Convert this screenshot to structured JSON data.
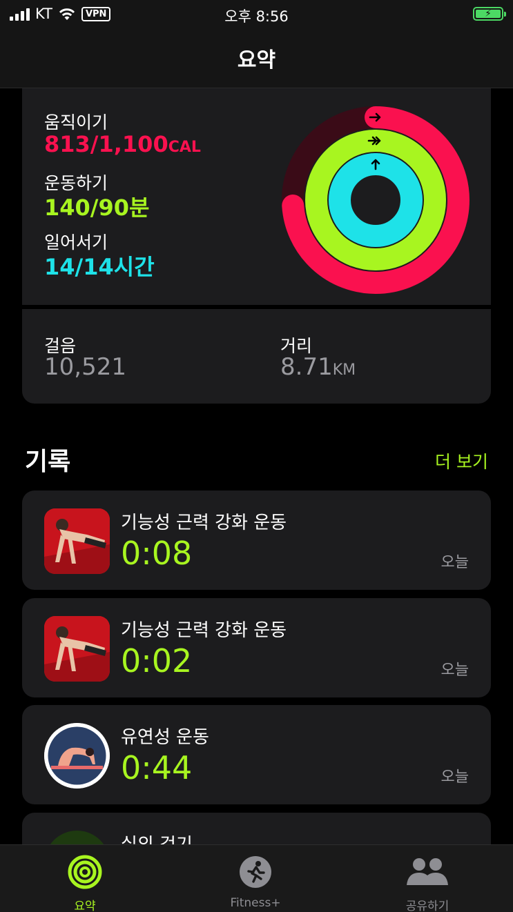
{
  "status_bar": {
    "carrier": "KT",
    "vpn": "VPN",
    "time": "오후 8:56",
    "battery_symbol": "⚡"
  },
  "nav": {
    "title": "요약"
  },
  "activity": {
    "move": {
      "label": "움직이기",
      "value": "813/1,100",
      "unit": "CAL",
      "progress": 0.739,
      "color": "#fa114f"
    },
    "exercise": {
      "label": "운동하기",
      "value": "140/90분",
      "progress": 1.556,
      "color": "#a8f520"
    },
    "stand": {
      "label": "일어서기",
      "value": "14/14시간",
      "progress": 1.0,
      "color": "#1ee2e8"
    }
  },
  "stats": {
    "steps": {
      "label": "걸음",
      "value": "10,521"
    },
    "distance": {
      "label": "거리",
      "value": "8.71",
      "unit": "KM"
    }
  },
  "history": {
    "title": "기록",
    "more_label": "더 보기",
    "workouts": [
      {
        "name": "기능성 근력 강화 운동",
        "time": "0:08",
        "date": "오늘",
        "icon": "pushup-icon"
      },
      {
        "name": "기능성 근력 강화 운동",
        "time": "0:02",
        "date": "오늘",
        "icon": "pushup-icon"
      },
      {
        "name": "유연성 운동",
        "time": "0:44",
        "date": "오늘",
        "icon": "stretch-icon"
      },
      {
        "name": "실외 걷기",
        "icon": "walking-icon"
      }
    ]
  },
  "tabbar": {
    "tabs": [
      {
        "label": "요약",
        "icon": "activity-rings-icon",
        "active": true
      },
      {
        "label": "Fitness+",
        "icon": "runner-icon",
        "active": false
      },
      {
        "label": "공유하기",
        "icon": "people-icon",
        "active": false
      }
    ]
  }
}
